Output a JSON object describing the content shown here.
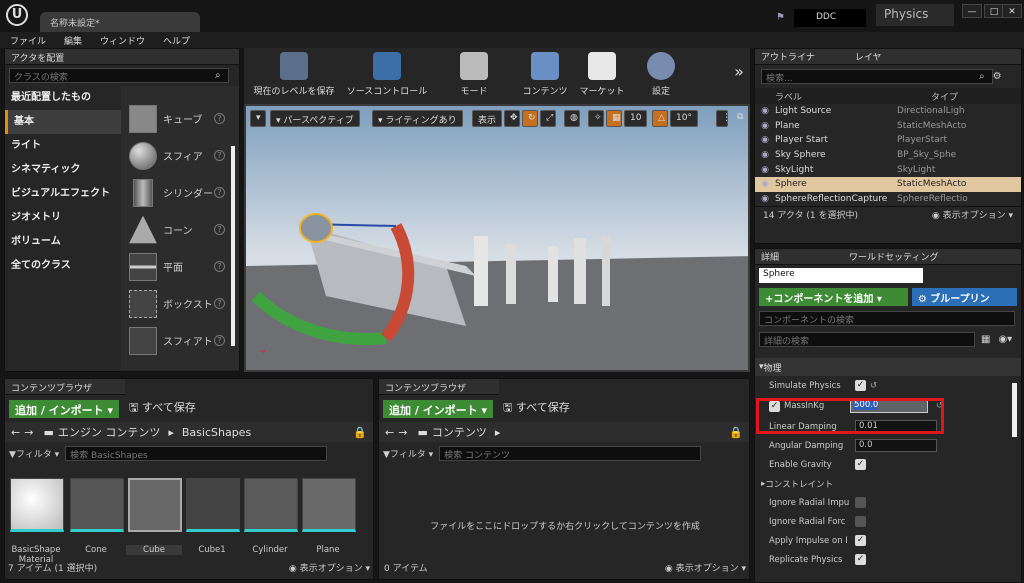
{
  "titlebar": {
    "logo": "U",
    "tab": "名称未設定*",
    "ddc": "DDC",
    "project": "Physics",
    "win_min": "—",
    "win_max": "□",
    "win_close": "✕"
  },
  "menu": [
    "ファイル",
    "編集",
    "ウィンドウ",
    "ヘルプ"
  ],
  "place": {
    "tab": "アクタを配置",
    "search_placeholder": "クラスの検索",
    "categories": [
      "最近配置したもの",
      "基本",
      "ライト",
      "シネマティック",
      "ビジュアルエフェクト",
      "ジオメトリ",
      "ボリューム",
      "全てのクラス"
    ],
    "items": [
      "キューブ",
      "スフィア",
      "シリンダー",
      "コーン",
      "平面",
      "ボックスト",
      "スフィアト"
    ]
  },
  "toolbar": {
    "save": "現在のレベルを保存",
    "source": "ソースコントロール",
    "mode": "モード",
    "content": "コンテンツ",
    "market": "マーケット",
    "settings": "設定",
    "more": "»"
  },
  "viewport": {
    "perspective": "パースペクティブ",
    "lit": "ライティングあり",
    "show": "表示",
    "grid": "10",
    "angle": "10°"
  },
  "outliner": {
    "tab": "アウトライナ",
    "tab2": "レイヤ",
    "search_placeholder": "検索...",
    "col_label": "ラベル",
    "col_type": "タイプ",
    "rows": [
      {
        "label": "Light Source",
        "type": "DirectionalLigh"
      },
      {
        "label": "Plane",
        "type": "StaticMeshActo"
      },
      {
        "label": "Player Start",
        "type": "PlayerStart"
      },
      {
        "label": "Sky Sphere",
        "type": "BP_Sky_Sphe"
      },
      {
        "label": "SkyLight",
        "type": "SkyLight"
      },
      {
        "label": "Sphere",
        "type": "StaticMeshActo"
      },
      {
        "label": "SphereReflectionCapture",
        "type": "SphereReflectio"
      }
    ],
    "footer": "14 アクタ (1 を選択中)",
    "view_options": "表示オプション"
  },
  "details": {
    "tab": "詳細",
    "tab2": "ワールドセッティング",
    "name": "Sphere",
    "add_component": "+コンポーネントを追加",
    "blueprint": "ブループリン",
    "component_search": "コンポーネントの検索",
    "detail_search": "詳細の検索",
    "section_physics": "物理",
    "simulate_physics": "Simulate Physics",
    "mass_label": "MassInKg",
    "mass_value": "500.0",
    "linear_damping": "Linear Damping",
    "linear_damping_value": "0.01",
    "angular_damping": "Angular Damping",
    "angular_damping_value": "0.0",
    "enable_gravity": "Enable Gravity",
    "constraints": "コンストレイント",
    "ignore_impulse": "Ignore Radial Impu",
    "ignore_force": "Ignore Radial Forc",
    "apply_impulse": "Apply Impulse on I",
    "replicate": "Replicate Physics"
  },
  "cb1": {
    "tab": "コンテンツブラウザ",
    "add": "追加 / インポート",
    "save_all": "すべて保存",
    "path1": "エンジン コンテンツ",
    "path2": "BasicShapes",
    "filter": "フィルタ",
    "search_placeholder": "検索 BasicShapes",
    "assets": [
      "BasicShape Material",
      "Cone",
      "Cube",
      "Cube1",
      "Cylinder",
      "Plane"
    ],
    "footer": "7 アイテム (1 選択中)",
    "view_options": "表示オプション"
  },
  "cb2": {
    "tab": "コンテンツブラウザ",
    "add": "追加 / インポート",
    "save_all": "すべて保存",
    "path1": "コンテンツ",
    "filter": "フィルタ",
    "search_placeholder": "検索 コンテンツ",
    "empty_text": "ファイルをここにドロップするか右クリックしてコンテンツを作成",
    "footer": "0 アイテム",
    "view_options": "表示オプション"
  }
}
